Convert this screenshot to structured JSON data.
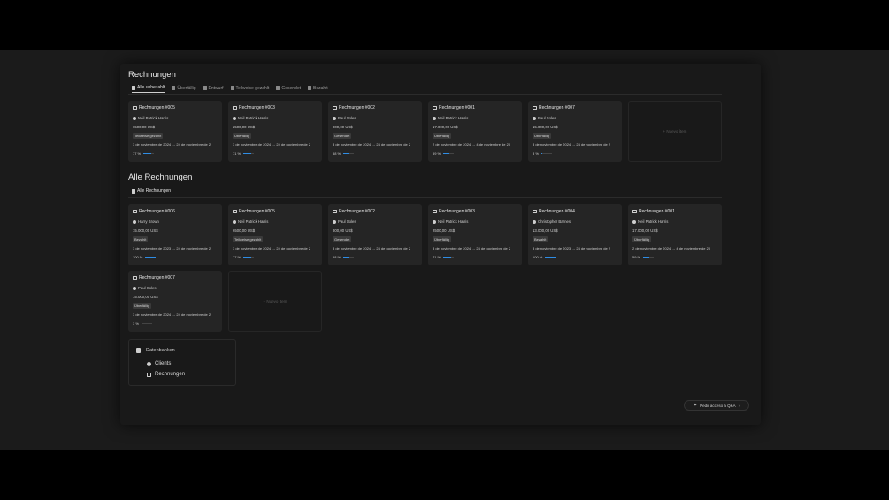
{
  "section1": {
    "title": "Rechnungen",
    "tabs": [
      "Alle unbezahlt",
      "Überfällig",
      "Entwurf",
      "Teilweise gezahlt",
      "Gesendet",
      "Bezahlt"
    ],
    "cards": [
      {
        "title": "Rechnungen #005",
        "client": "Neil Patrick Harris",
        "amount": "6500,00 US$",
        "status": "Teilweise gezahlt",
        "dates": "3 de noviembre de 2024 → 24 de noviembre de 2",
        "progress": "77 %",
        "progress_value": 0.77
      },
      {
        "title": "Rechnungen #003",
        "client": "Neil Patrick Harris",
        "amount": "2500,00 US$",
        "status": "Überfällig",
        "dates": "3 de noviembre de 2024 → 24 de noviembre de 2",
        "progress": "71 %",
        "progress_value": 0.71
      },
      {
        "title": "Rechnungen #002",
        "client": "Paul Soles",
        "amount": "800,00 US$",
        "status": "Gesendet",
        "dates": "3 de noviembre de 2024 → 24 de noviembre de 2",
        "progress": "58 %",
        "progress_value": 0.58
      },
      {
        "title": "Rechnungen #001",
        "client": "Neil Patrick Harris",
        "amount": "17.000,00 US$",
        "status": "Überfällig",
        "dates": "2 de noviembre de 2024 → 4 de noviembre de 20",
        "progress": "59 %",
        "progress_value": 0.59
      },
      {
        "title": "Rechnungen #007",
        "client": "Paul Soles",
        "amount": "15.000,00 US$",
        "status": "Überfällig",
        "dates": "3 de noviembre de 2024 → 24 de noviembre de 2",
        "progress": "3 %",
        "progress_value": 0.03
      }
    ],
    "new_item": "+ Nuevo ítem"
  },
  "section2": {
    "title": "Alle Rechnungen",
    "tabs": [
      "Alle Rechnungen"
    ],
    "cards": [
      {
        "title": "Rechnungen #006",
        "client": "Harry Brown",
        "amount": "15.000,00 US$",
        "status": "Bezahlt",
        "dates": "3 de noviembre de 2023 → 24 de noviembre de 2",
        "progress": "100 %",
        "progress_value": 1.0
      },
      {
        "title": "Rechnungen #005",
        "client": "Neil Patrick Harris",
        "amount": "6500,00 US$",
        "status": "Teilweise gezahlt",
        "dates": "3 de noviembre de 2024 → 24 de noviembre de 2",
        "progress": "77 %",
        "progress_value": 0.77
      },
      {
        "title": "Rechnungen #002",
        "client": "Paul Soles",
        "amount": "800,00 US$",
        "status": "Gesendet",
        "dates": "3 de noviembre de 2024 → 24 de noviembre de 2",
        "progress": "58 %",
        "progress_value": 0.58
      },
      {
        "title": "Rechnungen #003",
        "client": "Neil Patrick Harris",
        "amount": "2500,00 US$",
        "status": "Überfällig",
        "dates": "3 de noviembre de 2024 → 24 de noviembre de 2",
        "progress": "71 %",
        "progress_value": 0.71
      },
      {
        "title": "Rechnungen #004",
        "client": "Christopher Barnes",
        "amount": "13.000,00 US$",
        "status": "Bezahlt",
        "dates": "3 de noviembre de 2023 → 24 de noviembre de 2",
        "progress": "100 %",
        "progress_value": 1.0
      },
      {
        "title": "Rechnungen #001",
        "client": "Neil Patrick Harris",
        "amount": "17.000,00 US$",
        "status": "Überfällig",
        "dates": "2 de noviembre de 2024 → 4 de noviembre de 20",
        "progress": "59 %",
        "progress_value": 0.59
      },
      {
        "title": "Rechnungen #007",
        "client": "Paul Soles",
        "amount": "15.000,00 US$",
        "status": "Überfällig",
        "dates": "3 de noviembre de 2024 → 24 de noviembre de 2",
        "progress": "3 %",
        "progress_value": 0.03
      }
    ],
    "new_item": "+ Nuevo ítem"
  },
  "databases": {
    "title": "Datenbanken",
    "items": [
      "Clients",
      "Rechnungen"
    ]
  },
  "qa_button": "Pedir acceso a Q&A",
  "colors": {
    "progress": "#2f8de4",
    "card_bg": "#252525",
    "page_bg": "#191919"
  }
}
